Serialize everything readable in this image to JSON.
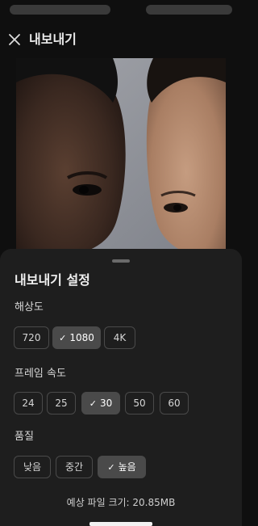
{
  "header": {
    "title": "내보내기",
    "close_icon": "close-icon"
  },
  "preview": {
    "image": "preview-image"
  },
  "sheet": {
    "title": "내보내기 설정",
    "resolution": {
      "label": "해상도",
      "options": [
        "720",
        "1080",
        "4K"
      ],
      "selected": "1080"
    },
    "frame_rate": {
      "label": "프레임 속도",
      "options": [
        "24",
        "25",
        "30",
        "50",
        "60"
      ],
      "selected": "30"
    },
    "quality": {
      "label": "품질",
      "options": [
        "낮음",
        "중간",
        "높음"
      ],
      "selected": "높음"
    },
    "file_size": "예상 파일 크기: 20.85MB"
  },
  "colors": {
    "background": "#0f0f0f",
    "sheet": "#1e1e1e",
    "chip_border": "#4a4a4a",
    "chip_selected": "#4a4a4a"
  }
}
